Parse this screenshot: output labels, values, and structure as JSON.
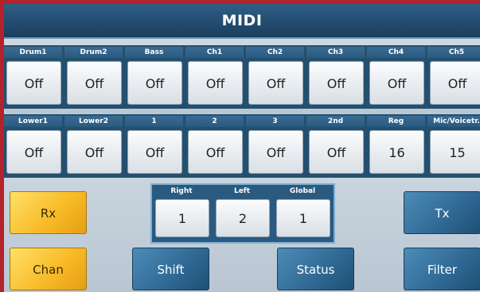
{
  "title": "MIDI",
  "row1": [
    {
      "label": "Drum1",
      "value": "Off"
    },
    {
      "label": "Drum2",
      "value": "Off"
    },
    {
      "label": "Bass",
      "value": "Off"
    },
    {
      "label": "Ch1",
      "value": "Off"
    },
    {
      "label": "Ch2",
      "value": "Off"
    },
    {
      "label": "Ch3",
      "value": "Off"
    },
    {
      "label": "Ch4",
      "value": "Off"
    },
    {
      "label": "Ch5",
      "value": "Off"
    }
  ],
  "row2": [
    {
      "label": "Lower1",
      "value": "Off"
    },
    {
      "label": "Lower2",
      "value": "Off"
    },
    {
      "label": "1",
      "value": "Off"
    },
    {
      "label": "2",
      "value": "Off"
    },
    {
      "label": "3",
      "value": "Off"
    },
    {
      "label": "2nd",
      "value": "Off"
    },
    {
      "label": "Reg",
      "value": "16"
    },
    {
      "label": "Mic/Voicetr.",
      "value": "15"
    }
  ],
  "split": [
    {
      "label": "Right",
      "value": "1"
    },
    {
      "label": "Left",
      "value": "2"
    },
    {
      "label": "Global",
      "value": "1"
    }
  ],
  "buttons": {
    "rx": "Rx",
    "tx": "Tx",
    "chan": "Chan",
    "shift": "Shift",
    "status": "Status",
    "filter": "Filter"
  },
  "colors": {
    "frame": "#b3232b",
    "panel": "#24506f",
    "active": "#f7b925",
    "inactive": "#2a628c"
  }
}
